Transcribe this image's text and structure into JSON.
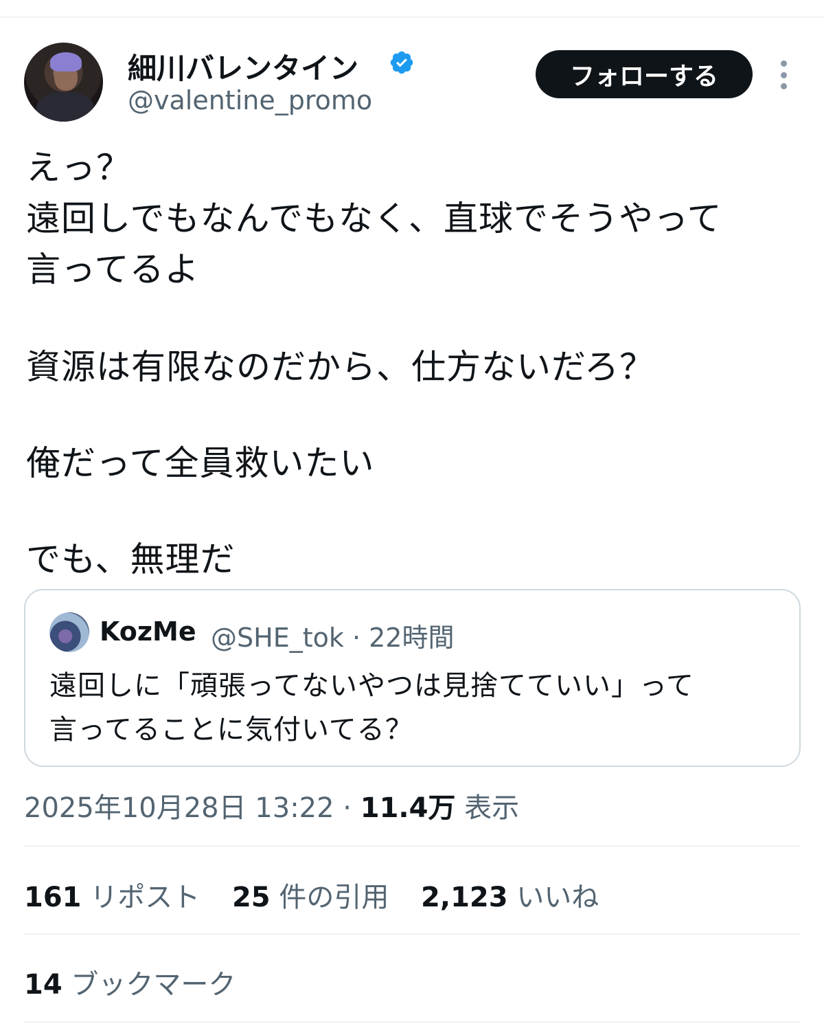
{
  "author": {
    "display_name": "細川バレンタイン",
    "handle": "@valentine_promo",
    "verified": true,
    "verified_color": "#1d9bf0"
  },
  "follow_button": {
    "label": "フォローする"
  },
  "tweet": {
    "lines": [
      "えっ？",
      "遠回しでもなんでもなく、直球でそうやって",
      "言ってるよ",
      "資源は有限なのだから、仕方ないだろ？",
      "俺だって全員救いたい",
      "でも、無理だ"
    ]
  },
  "quote": {
    "name": "KozMe",
    "handle_time": "@SHE_tok · 22時間",
    "lines": [
      "遠回しに「頑張ってないやつは見捨てていい」って",
      "言ってることに気付いてる？"
    ]
  },
  "meta": {
    "timestamp": "2025年10月28日 13:22 · ",
    "views_count": "11.4万",
    "views_label": " 表示"
  },
  "stats": {
    "reposts_count": "161",
    "reposts_label": " リポスト",
    "quotes_count": "25",
    "quotes_label": " 件の引用",
    "likes_count": "2,123",
    "likes_label": " いいね",
    "bookmarks_count": "14",
    "bookmarks_label": " ブックマーク"
  }
}
